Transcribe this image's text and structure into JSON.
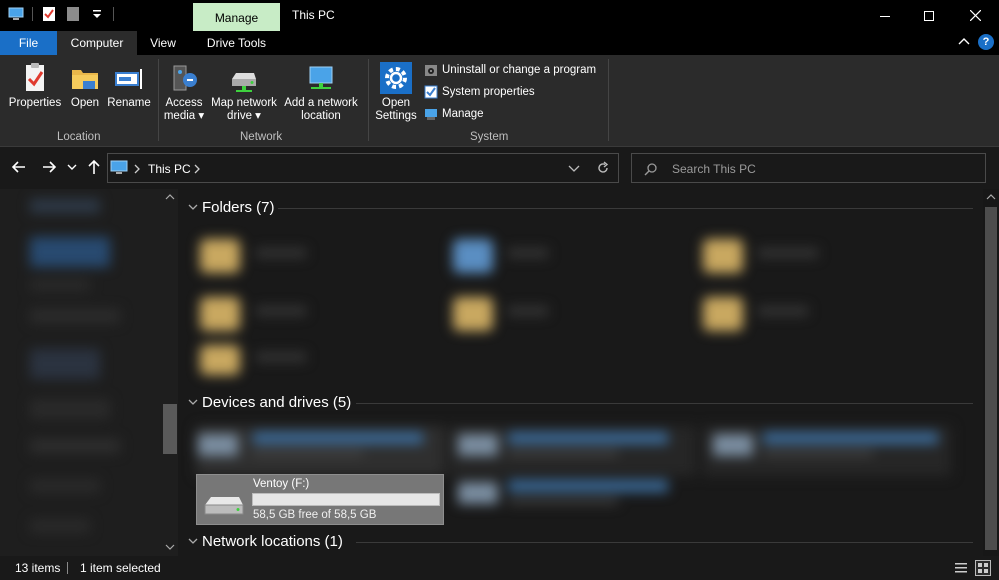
{
  "title_bar": {
    "context_tab": "Manage",
    "window_title": "This PC"
  },
  "tabs": {
    "file": "File",
    "computer": "Computer",
    "view": "View",
    "drive_tools": "Drive Tools"
  },
  "ribbon": {
    "location": {
      "label": "Location",
      "properties": "Properties",
      "open": "Open",
      "rename": "Rename"
    },
    "network": {
      "label": "Network",
      "access_media_1": "Access",
      "access_media_2": "media",
      "map_drive_1": "Map network",
      "map_drive_2": "drive",
      "add_location_1": "Add a network",
      "add_location_2": "location"
    },
    "system": {
      "label": "System",
      "open_settings_1": "Open",
      "open_settings_2": "Settings",
      "uninstall": "Uninstall or change a program",
      "system_properties": "System properties",
      "manage": "Manage"
    }
  },
  "address": {
    "location": "This PC",
    "search_placeholder": "Search This PC"
  },
  "content": {
    "folders_header": "Folders (7)",
    "devices_header": "Devices and drives (5)",
    "network_header": "Network locations (1)",
    "ventoy": {
      "name": "Ventoy (F:)",
      "free": "58,5 GB free of 58,5 GB",
      "used_fraction": 0.0
    }
  },
  "status": {
    "items": "13 items",
    "selected": "1 item selected"
  },
  "colors": {
    "accent": "#1a6fc7",
    "context_tab": "#c8ecc6",
    "ribbon_bg": "#2b2b2b",
    "window_bg": "#191919"
  }
}
